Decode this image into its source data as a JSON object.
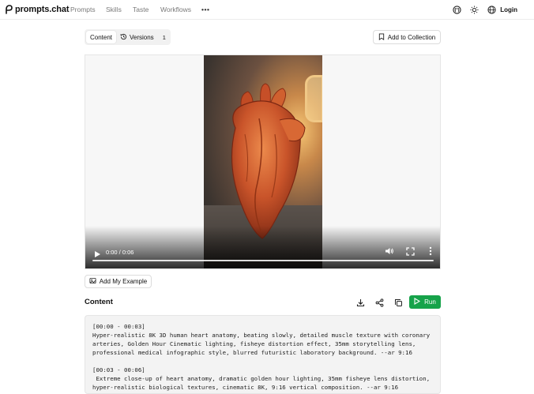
{
  "app": {
    "name": "prompts.chat"
  },
  "nav": {
    "items": [
      "Prompts",
      "Skills",
      "Taste",
      "Workflows"
    ],
    "more": "•••"
  },
  "header": {
    "login_label": "Login"
  },
  "tabs": {
    "content_label": "Content",
    "versions_label": "Versions",
    "versions_count": "1"
  },
  "actions": {
    "add_collection_label": "Add to Collection",
    "add_example_label": "Add My Example",
    "run_label": "Run"
  },
  "video": {
    "time": "0:00 / 0:06",
    "progress": 0
  },
  "content": {
    "title": "Content",
    "text": "[00:00 - 00:03]\nHyper-realistic 8K 3D human heart anatomy, beating slowly, detailed muscle texture with coronary arteries, Golden Hour Cinematic lighting, fisheye distortion effect, 35mm storytelling lens, professional medical infographic style, blurred futuristic laboratory background. --ar 9:16\n\n[00:03 - 00:06]\n Extreme close-up of heart anatomy, dramatic golden hour lighting, 35mm fisheye lens distortion, hyper-realistic biological textures, cinematic 8K, 9:16 vertical composition. --ar 9:16"
  },
  "colors": {
    "run": "#16a34a",
    "border": "#e5e5e5"
  }
}
